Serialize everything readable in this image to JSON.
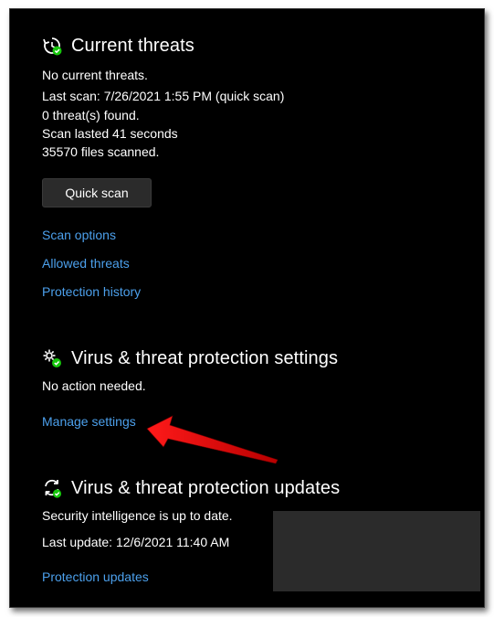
{
  "current_threats": {
    "title": "Current threats",
    "icon": "clock-refresh-icon",
    "lines": [
      "No current threats.",
      "Last scan: 7/26/2021 1:55 PM (quick scan)",
      "0 threat(s) found.",
      "Scan lasted 41 seconds",
      "35570 files scanned."
    ],
    "quick_scan_label": "Quick scan",
    "links": [
      "Scan options",
      "Allowed threats",
      "Protection history"
    ]
  },
  "protection_settings": {
    "title": "Virus & threat protection settings",
    "icon": "gear-check-icon",
    "status": "No action needed.",
    "link": "Manage settings"
  },
  "protection_updates": {
    "title": "Virus & threat protection updates",
    "icon": "refresh-check-icon",
    "lines": [
      "Security intelligence is up to date.",
      "Last update: 12/6/2021 11:40 AM"
    ],
    "link": "Protection updates"
  },
  "colors": {
    "background": "#000000",
    "link": "#4ca0ec",
    "button": "#2b2b2b",
    "status_ok": "#16c60c",
    "annotation_arrow": "#e8141c",
    "overlay_box": "#2b2b2b"
  }
}
